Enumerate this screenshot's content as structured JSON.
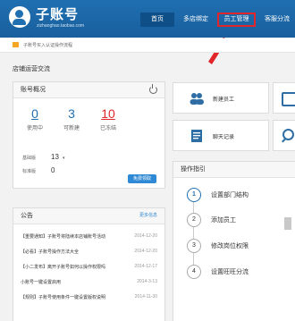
{
  "header": {
    "logo_name": "子账号",
    "logo_domain": "zizhanghao.taobao.com",
    "nav": [
      "首页",
      "多店绑定",
      "员工管理",
      "客服分流"
    ]
  },
  "notice": "子账号买入认证操作流程",
  "section_title": "店铺运营交流",
  "account": {
    "title": "账号概况",
    "stats": [
      {
        "num": "0",
        "label": "使用中",
        "color": "#1f6fb1"
      },
      {
        "num": "3",
        "label": "可新建",
        "color": "#1f6fb1"
      },
      {
        "num": "10",
        "label": "已冻结",
        "color": "#e0262a"
      }
    ],
    "basic_label": "基础版",
    "basic_value": "13",
    "standard_label": "标准版",
    "standard_value": "0",
    "free_button": "免费领取"
  },
  "announcements": {
    "title": "公告",
    "more": "更多信息",
    "items": [
      {
        "text": "【重要通知】子账号将陆续本店铺账号活动",
        "date": "2014-12-20"
      },
      {
        "text": "【必看】子账号操作方法大全",
        "date": "2014-12-20"
      },
      {
        "text": "【小二发布】离开子账号如何以操作权限吗",
        "date": "2014-12-17"
      },
      {
        "text": "小账号一键设置启用",
        "date": "2014-3-13"
      },
      {
        "text": "【规则】子账号使用条件一键设置版权说明",
        "date": "2014-11-30"
      }
    ]
  },
  "quick": {
    "new_employee": "新建员工",
    "backup": "聊天记录"
  },
  "guide": {
    "title": "操作指引",
    "steps": [
      "设置部门结构",
      "添加员工",
      "修改岗位权限",
      "设置旺旺分流"
    ]
  },
  "colors": {
    "brand": "#1f6fb1",
    "alert": "#e0262a",
    "button": "#2f89d4"
  }
}
